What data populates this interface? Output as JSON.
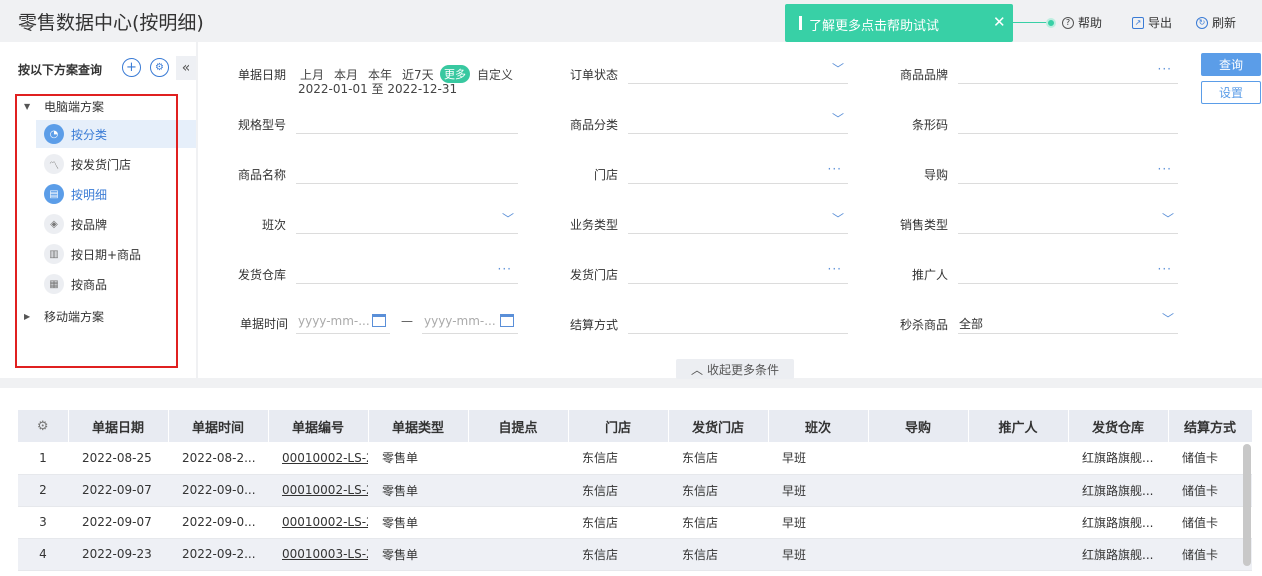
{
  "page": {
    "title": "零售数据中心(按明细)"
  },
  "toast": {
    "text": "了解更多点击帮助试试",
    "close": "✕"
  },
  "topbar": {
    "help": "帮助",
    "export": "导出",
    "refresh": "刷新"
  },
  "left": {
    "title": "按以下方案查询",
    "collapse": "«",
    "groups": [
      {
        "label": "电脑端方案",
        "expanded": true
      },
      {
        "label": "移动端方案",
        "expanded": false
      }
    ],
    "items": [
      {
        "label": "按分类",
        "selected": true,
        "icon": "pie-chart-icon"
      },
      {
        "label": "按发货门店",
        "selected": false,
        "icon": "line-chart-icon"
      },
      {
        "label": "按明细",
        "selected": false,
        "active": true,
        "icon": "detail-icon"
      },
      {
        "label": "按品牌",
        "selected": false,
        "icon": "brand-icon"
      },
      {
        "label": "按日期+商品",
        "selected": false,
        "icon": "bar-chart-icon"
      },
      {
        "label": "按商品",
        "selected": false,
        "icon": "product-icon"
      }
    ]
  },
  "filters": {
    "date_label": "单据日期",
    "date_options": [
      "上月",
      "本月",
      "本年",
      "近7天",
      "更多",
      "自定义"
    ],
    "date_range": "2022-01-01 至 2022-12-31",
    "order_status": "订单状态",
    "brand": "商品品牌",
    "spec": "规格型号",
    "category": "商品分类",
    "barcode": "条形码",
    "product_name": "商品名称",
    "store": "门店",
    "guide": "导购",
    "shift": "班次",
    "biz_type": "业务类型",
    "sale_type": "销售类型",
    "ship_warehouse": "发货仓库",
    "ship_store": "发货门店",
    "promoter": "推广人",
    "doc_time": "单据时间",
    "time_placeholder": "yyyy-mm-...",
    "time_sep": "—",
    "settle": "结算方式",
    "flash_sale": "秒杀商品",
    "flash_sale_value": "全部",
    "query_btn": "查询",
    "settings_btn": "设置",
    "collapse_more": "收起更多条件"
  },
  "table": {
    "columns": [
      "单据日期",
      "单据时间",
      "单据编号",
      "单据类型",
      "自提点",
      "门店",
      "发货门店",
      "班次",
      "导购",
      "推广人",
      "发货仓库",
      "结算方式"
    ],
    "rows": [
      [
        "1",
        "2022-08-25",
        "2022-08-2...",
        "00010002-LS-2",
        "零售单",
        "",
        "东信店",
        "东信店",
        "早班",
        "",
        "",
        "红旗路旗舰...",
        "储值卡"
      ],
      [
        "2",
        "2022-09-07",
        "2022-09-0...",
        "00010002-LS-2",
        "零售单",
        "",
        "东信店",
        "东信店",
        "早班",
        "",
        "",
        "红旗路旗舰...",
        "储值卡"
      ],
      [
        "3",
        "2022-09-07",
        "2022-09-0...",
        "00010002-LS-2",
        "零售单",
        "",
        "东信店",
        "东信店",
        "早班",
        "",
        "",
        "红旗路旗舰...",
        "储值卡"
      ],
      [
        "4",
        "2022-09-23",
        "2022-09-2...",
        "00010003-LS-2",
        "零售单",
        "",
        "东信店",
        "东信店",
        "早班",
        "",
        "",
        "红旗路旗舰...",
        "储值卡"
      ]
    ]
  },
  "colors": {
    "accent": "#5b9de8",
    "toast": "#38d0a6",
    "highlight": "#e02020"
  }
}
